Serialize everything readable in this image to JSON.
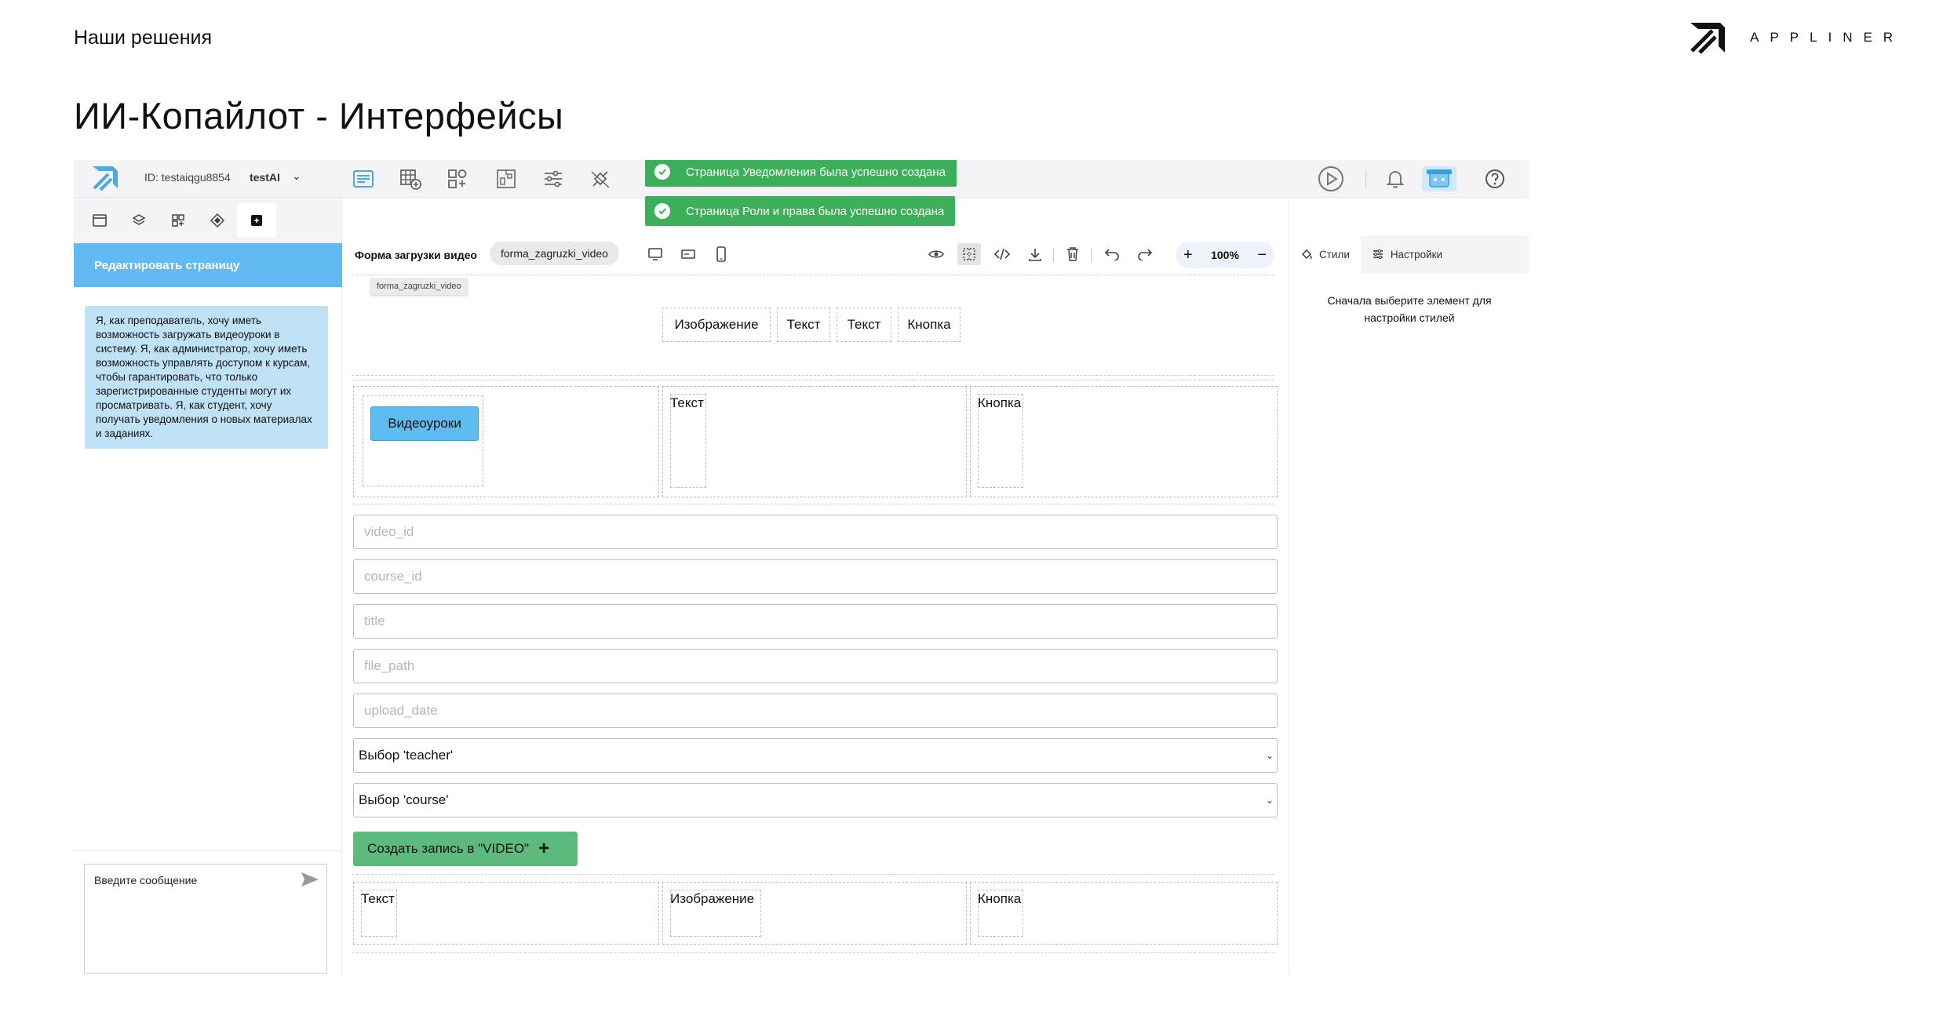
{
  "slide": {
    "kicker": "Наши решения",
    "title": "ИИ-Копайлот - Интерфейсы",
    "brand": "APPLINER"
  },
  "topbar": {
    "account_id": "ID: testaiqgu8854",
    "account_name": "testAI",
    "toasts": [
      "Страница Уведомления была успешно создана",
      "Страница Роли и права была успешно создана"
    ]
  },
  "left_panel": {
    "edit_page_label": "Редактировать страницу",
    "user_story": "Я, как преподаватель, хочу иметь возможность загружать видеоуроки в систему. Я, как администратор, хочу иметь возможность управлять доступом к курсам, чтобы гарантировать, что только зарегистрированные студенты могут их просматривать. Я, как студент, хочу получать уведомления о новых материалах и заданиях.",
    "message_placeholder": "Введите сообщение"
  },
  "canvas": {
    "form_title": "Форма загрузки видео",
    "form_slug": "forma_zagruzki_video",
    "slug_tooltip": "forma_zagruzki_video",
    "zoom": "100%",
    "header_chips": [
      "Изображение",
      "Текст",
      "Текст",
      "Кнопка"
    ],
    "row1": {
      "button_label": "Видеоуроки",
      "middle_label": "Текст",
      "right_label": "Кнопка"
    },
    "fields": [
      "video_id",
      "course_id",
      "title",
      "file_path",
      "upload_date"
    ],
    "selects": [
      "Выбор 'teacher'",
      "Выбор 'course'"
    ],
    "create_button": "Создать запись в \"VIDEO\"",
    "footer_row": [
      "Текст",
      "Изображение",
      "Кнопка"
    ]
  },
  "right_panel": {
    "tab_styles": "Стили",
    "tab_settings": "Настройки",
    "hint": "Сначала выберите элемент для настройки стилей"
  },
  "colors": {
    "accent_blue": "#62baf2",
    "success_green": "#3dae59",
    "create_green": "#5cba7d"
  }
}
